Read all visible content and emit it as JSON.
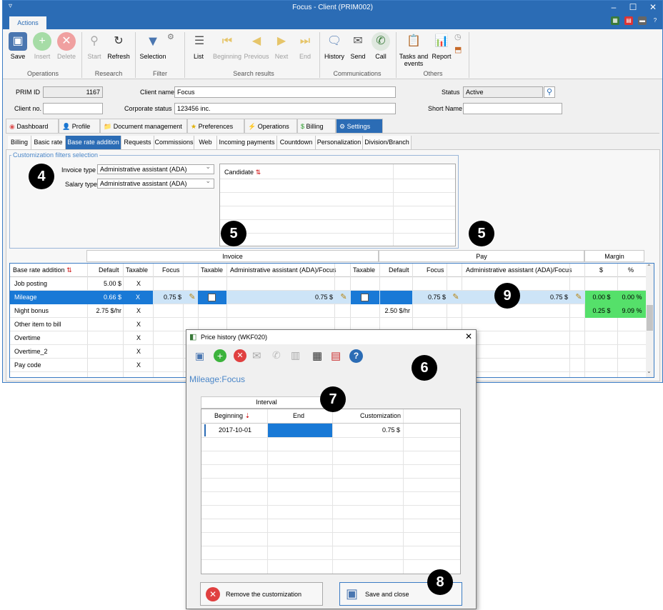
{
  "window": {
    "title": "Focus - Client (PRIM002)",
    "menu_glyph": "▿"
  },
  "ribbon_tab": "Actions",
  "toolbar": {
    "operations": [
      {
        "label": "Save",
        "icon": "save-icon",
        "enabled": true
      },
      {
        "label": "Insert",
        "icon": "plus-icon",
        "enabled": false
      },
      {
        "label": "Delete",
        "icon": "delete-icon",
        "enabled": false
      }
    ],
    "research": [
      {
        "label": "Start",
        "icon": "search-icon",
        "enabled": false
      },
      {
        "label": "Refresh",
        "icon": "refresh-icon",
        "enabled": true
      }
    ],
    "filter": [
      {
        "label": "Selection",
        "icon": "funnel-icon",
        "enabled": true
      }
    ],
    "search_results": [
      {
        "label": "List",
        "icon": "list-icon",
        "enabled": true
      },
      {
        "label": "Beginning",
        "icon": "first-icon",
        "enabled": false
      },
      {
        "label": "Previous",
        "icon": "previous-icon",
        "enabled": false
      },
      {
        "label": "Next",
        "icon": "next-icon",
        "enabled": false
      },
      {
        "label": "End",
        "icon": "last-icon",
        "enabled": false
      }
    ],
    "communications": [
      {
        "label": "History",
        "icon": "history-icon",
        "enabled": true
      },
      {
        "label": "Send",
        "icon": "mail-icon",
        "enabled": true
      },
      {
        "label": "Call",
        "icon": "phone-icon",
        "enabled": true
      }
    ],
    "others": [
      {
        "label": "Tasks and events",
        "icon": "clipboard-icon",
        "enabled": true
      },
      {
        "label": "Report",
        "icon": "report-icon",
        "enabled": true
      }
    ],
    "groups": {
      "operations": "Operations",
      "research": "Research",
      "filter": "Filter",
      "search_results": "Search results",
      "communications": "Communications",
      "others": "Others"
    }
  },
  "header": {
    "prim_id_label": "PRIM ID",
    "prim_id": "1167",
    "client_name_label": "Client name",
    "client_name": "Focus",
    "status_label": "Status",
    "status": "Active",
    "client_no_label": "Client no.",
    "client_no": "",
    "corporate_status_label": "Corporate status",
    "corporate_status": "123456 inc.",
    "short_name_label": "Short Name",
    "short_name": ""
  },
  "main_tabs": [
    "Dashboard",
    "Profile",
    "Document management",
    "Preferences",
    "Operations",
    "Billing",
    "Settings"
  ],
  "sub_tabs": [
    "Billing",
    "Basic rate",
    "Base rate addition",
    "Requests",
    "Commissions",
    "Web",
    "Incoming payments",
    "Countdown",
    "Personalization",
    "Division/Branch"
  ],
  "filters": {
    "legend": "Customization filters selection",
    "invoice_type_label": "Invoice type",
    "invoice_type": "Administrative assistant (ADA)",
    "salary_type_label": "Salary type",
    "salary_type": "Administrative assistant (ADA)",
    "candidate_header": "Candidate"
  },
  "callouts": {
    "c4": "4",
    "c5a": "5",
    "c5b": "5",
    "c6": "6",
    "c7": "7",
    "c8": "8",
    "c9": "9"
  },
  "grid": {
    "groups": {
      "invoice": "Invoice",
      "pay": "Pay",
      "margin": "Margin"
    },
    "columns": {
      "name": "Base rate addition",
      "inv_default": "Default",
      "inv_taxable": "Taxable",
      "inv_focus": "Focus",
      "inv_taxable2": "Taxable",
      "inv_ada": "Administrative assistant (ADA)/Focus",
      "pay_taxable": "Taxable",
      "pay_default": "Default",
      "pay_focus": "Focus",
      "pay_ada": "Administrative assistant (ADA)/Focus",
      "m_dollar": "$",
      "m_pct": "%"
    },
    "rows": [
      {
        "name": "Job posting",
        "inv_default": "5.00 $",
        "inv_taxable": "X"
      },
      {
        "name": "Mileage",
        "inv_default": "0.66 $",
        "inv_taxable": "X",
        "inv_focus": "0.75 $",
        "inv_ada": "0.75 $",
        "pay_focus": "0.75 $",
        "pay_ada": "0.75 $",
        "m_dollar": "0.00 $",
        "m_pct": "0.00 %"
      },
      {
        "name": "Night bonus",
        "inv_default": "2.75 $/hr",
        "inv_taxable": "X",
        "pay_default": "2.50 $/hr",
        "m_dollar": "0.25 $",
        "m_pct": "9.09 %"
      },
      {
        "name": "Other item to bill",
        "inv_taxable": "X"
      },
      {
        "name": "Overtime",
        "inv_taxable": "X"
      },
      {
        "name": "Overtime_2",
        "inv_taxable": "X"
      },
      {
        "name": "Pay code",
        "inv_taxable": "X"
      }
    ]
  },
  "dialog": {
    "title": "Price history (WKF020)",
    "subtitle": "Mileage:Focus",
    "interval": "Interval",
    "col_beginning": "Beginning",
    "col_end": "End",
    "col_customization": "Customization",
    "row_beginning": "2017-10-01",
    "row_customization": "0.75 $",
    "remove_label": "Remove the customization",
    "save_label": "Save and close"
  },
  "colors": {
    "accent": "#2b6cb5",
    "selection": "#1979d6",
    "margin_green": "#55e06a"
  }
}
